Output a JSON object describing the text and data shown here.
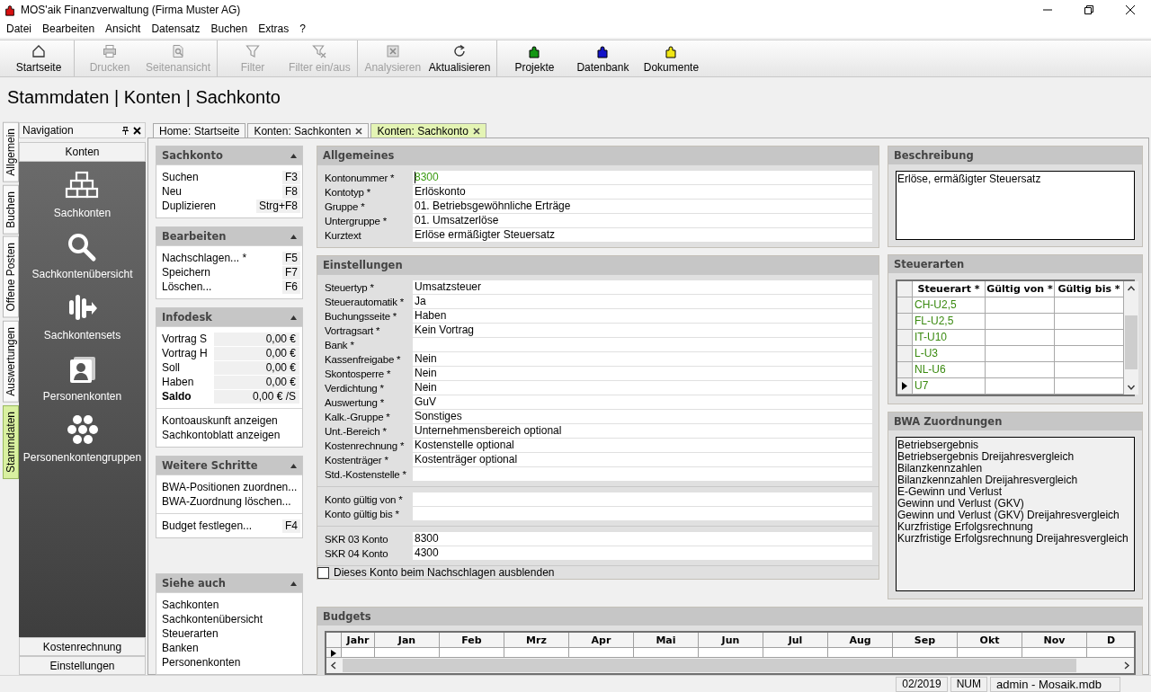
{
  "window": {
    "title": "MOS'aik Finanzverwaltung (Firma Muster AG)"
  },
  "menu": [
    {
      "label": "Datei"
    },
    {
      "label": "Bearbeiten"
    },
    {
      "label": "Ansicht"
    },
    {
      "label": "Datensatz"
    },
    {
      "label": "Buchen"
    },
    {
      "label": "Extras"
    },
    {
      "label": "?"
    }
  ],
  "toolbar": [
    [
      {
        "label": "Startseite",
        "kind": "home",
        "disabled": false
      }
    ],
    [
      {
        "label": "Drucken",
        "kind": "print",
        "disabled": true
      },
      {
        "label": "Seitenansicht",
        "kind": "preview",
        "disabled": true
      }
    ],
    [
      {
        "label": "Filter",
        "kind": "filter",
        "disabled": true
      },
      {
        "label": "Filter ein/aus",
        "kind": "filter-toggle",
        "disabled": true
      }
    ],
    [
      {
        "label": "Analysieren",
        "kind": "analyze",
        "disabled": true
      },
      {
        "label": "Aktualisieren",
        "kind": "refresh",
        "disabled": false
      }
    ],
    [
      {
        "label": "Projekte",
        "kind": "puzzle",
        "color": "#139613",
        "disabled": false
      },
      {
        "label": "Datenbank",
        "kind": "puzzle",
        "color": "#1414c8",
        "disabled": false
      },
      {
        "label": "Dokumente",
        "kind": "puzzle",
        "color": "#f0e614",
        "disabled": false
      }
    ]
  ],
  "heading": "Stammdaten | Konten | Sachkonto",
  "side_tabs": [
    {
      "label": "Allgemein",
      "selected": false
    },
    {
      "label": "Buchen",
      "selected": false
    },
    {
      "label": "Offene Posten",
      "selected": false
    },
    {
      "label": "Auswertungen",
      "selected": false
    },
    {
      "label": "Stammdaten",
      "selected": true
    }
  ],
  "navigation": {
    "title": "Navigation",
    "section": "Konten",
    "items": [
      {
        "label": "Sachkonten",
        "kind": "bricks"
      },
      {
        "label": "Sachkontenübersicht",
        "kind": "search"
      },
      {
        "label": "Sachkontensets",
        "kind": "bars"
      },
      {
        "label": "Personenkonten",
        "kind": "person-card"
      },
      {
        "label": "Personenkontengruppen",
        "kind": "hexagons"
      }
    ],
    "bottom_sections": [
      "Kostenrechnung",
      "Einstellungen"
    ]
  },
  "doc_tabs": [
    {
      "label": "Home: Startseite",
      "closable": false,
      "selected": false
    },
    {
      "label": "Konten: Sachkonten",
      "closable": true,
      "selected": false
    },
    {
      "label": "Konten: Sachkonto",
      "closable": true,
      "selected": true
    }
  ],
  "task_panels": [
    {
      "title": "Sachkonto",
      "groups": [
        [
          {
            "kind": "action",
            "label": "Suchen",
            "shortcut": "F3"
          },
          {
            "kind": "action",
            "label": "Neu",
            "shortcut": "F8"
          },
          {
            "kind": "action",
            "label": "Duplizieren",
            "shortcut": "Strg+F8"
          }
        ]
      ]
    },
    {
      "title": "Bearbeiten",
      "groups": [
        [
          {
            "kind": "action",
            "label": "Nachschlagen... *",
            "shortcut": "F5"
          },
          {
            "kind": "action",
            "label": "Speichern",
            "shortcut": "F7"
          },
          {
            "kind": "action",
            "label": "Löschen...",
            "shortcut": "F6"
          }
        ]
      ]
    },
    {
      "title": "Infodesk",
      "groups": [
        [
          {
            "kind": "value",
            "label": "Vortrag S",
            "value": "0,00 €",
            "bold": false
          },
          {
            "kind": "value",
            "label": "Vortrag H",
            "value": "0,00 €",
            "bold": false
          },
          {
            "kind": "value",
            "label": "Soll",
            "value": "0,00 €",
            "bold": false
          },
          {
            "kind": "value",
            "label": "Haben",
            "value": "0,00 €",
            "bold": false
          },
          {
            "kind": "value",
            "label": "Saldo",
            "value": "0,00 € /S",
            "bold": true
          }
        ],
        [
          {
            "kind": "action",
            "label": "Kontoauskunft anzeigen"
          },
          {
            "kind": "action",
            "label": "Sachkontoblatt anzeigen"
          }
        ]
      ]
    },
    {
      "title": "Weitere Schritte",
      "groups": [
        [
          {
            "kind": "action",
            "label": "BWA-Positionen zuordnen..."
          },
          {
            "kind": "action",
            "label": "BWA-Zuordnung löschen..."
          }
        ],
        [
          {
            "kind": "action",
            "label": "Budget festlegen...",
            "shortcut": "F4"
          }
        ]
      ]
    },
    {
      "title": "Siehe auch",
      "groups": [
        [
          {
            "kind": "action",
            "label": "Sachkonten"
          },
          {
            "kind": "action",
            "label": "Sachkontenübersicht"
          },
          {
            "kind": "action",
            "label": "Steuerarten"
          },
          {
            "kind": "action",
            "label": "Banken"
          },
          {
            "kind": "action",
            "label": "Personenkonten"
          }
        ]
      ]
    }
  ],
  "allgemeines": {
    "title": "Allgemeines",
    "fields": [
      {
        "label": "Kontonummer *",
        "value": "8300",
        "focused": true
      },
      {
        "label": "Kontotyp *",
        "value": "Erlöskonto",
        "focused": false
      },
      {
        "label": "Gruppe *",
        "value": "01. Betriebsgewöhnliche Erträge",
        "focused": false
      },
      {
        "label": "Untergruppe *",
        "value": "01. Umsatzerlöse",
        "focused": false
      },
      {
        "label": "Kurztext",
        "value": "Erlöse ermäßigter Steuersatz",
        "focused": false
      }
    ]
  },
  "einstellungen": {
    "title": "Einstellungen",
    "groups": [
      [
        {
          "label": "Steuertyp *",
          "value": "Umsatzsteuer"
        },
        {
          "label": "Steuerautomatik *",
          "value": "Ja"
        },
        {
          "label": "Buchungsseite *",
          "value": "Haben"
        },
        {
          "label": "Vortragsart *",
          "value": "Kein Vortrag"
        },
        {
          "label": "Bank *"
        },
        {
          "label": "Kassenfreigabe *",
          "value": "Nein"
        },
        {
          "label": "Skontosperre *",
          "value": "Nein"
        },
        {
          "label": "Verdichtung *",
          "value": "Nein"
        },
        {
          "label": "Auswertung *",
          "value": "GuV"
        },
        {
          "label": "Kalk.-Gruppe *",
          "value": "Sonstiges"
        },
        {
          "label": "Unt.-Bereich *",
          "value": "Unternehmensbereich optional"
        },
        {
          "label": "Kostenrechnung *",
          "value": "Kostenstelle optional"
        },
        {
          "label": "Kostenträger *",
          "value": "Kostenträger optional"
        },
        {
          "label": "Std.-Kostenstelle *"
        }
      ],
      [
        {
          "label": "Konto gültig von *"
        },
        {
          "label": "Konto gültig bis *"
        }
      ],
      [
        {
          "label": "SKR 03 Konto",
          "value": "8300"
        },
        {
          "label": "SKR 04 Konto",
          "value": "4300"
        }
      ]
    ],
    "checkbox": {
      "label": "Dieses Konto beim Nachschlagen ausblenden",
      "checked": false
    }
  },
  "budgets": {
    "title": "Budgets",
    "columns": [
      "Jahr",
      "Jan",
      "Feb",
      "Mrz",
      "Apr",
      "Mai",
      "Jun",
      "Jul",
      "Aug",
      "Sep",
      "Okt",
      "Nov",
      "D"
    ],
    "rows": [
      {
        "current": true
      }
    ]
  },
  "beschreibung": {
    "title": "Beschreibung",
    "value": "Erlöse, ermäßigter Steuersatz"
  },
  "steuerarten": {
    "title": "Steuerarten",
    "columns": [
      "Steuerart *",
      "Gültig von *",
      "Gültig bis *"
    ],
    "rows": [
      {
        "steuerart": "CH-U2,5",
        "current": false
      },
      {
        "steuerart": "FL-U2,5",
        "current": false
      },
      {
        "steuerart": "IT-U10",
        "current": false
      },
      {
        "steuerart": "L-U3",
        "current": false
      },
      {
        "steuerart": "NL-U6",
        "current": false
      },
      {
        "steuerart": "U7",
        "current": true
      }
    ]
  },
  "bwa": {
    "title": "BWA Zuordnungen",
    "items": [
      "Betriebsergebnis",
      "Betriebsergebnis Dreijahresvergleich",
      "Bilanzkennzahlen",
      "Bilanzkennzahlen Dreijahresvergleich",
      "E-Gewinn und Verlust",
      "Gewinn und Verlust (GKV)",
      "Gewinn und Verlust (GKV) Dreijahresvergleich",
      "Kurzfristige Erfolgsrechnung",
      "Kurzfristige Erfolgsrechnung Dreijahresvergleich"
    ]
  },
  "status_bar": [
    "02/2019",
    "NUM",
    "admin - Mosaik.mdb"
  ]
}
